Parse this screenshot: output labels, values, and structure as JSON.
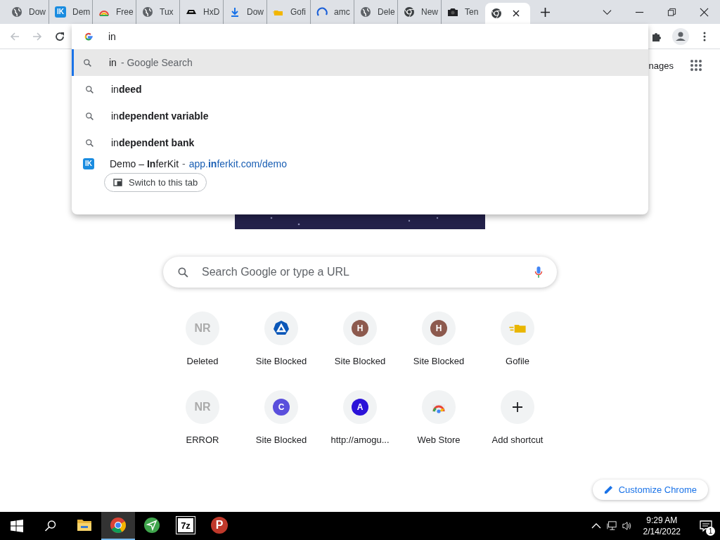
{
  "tabs": [
    {
      "title": "Dow",
      "kind": "globe",
      "selected": false
    },
    {
      "title": "Dem",
      "kind": "badge",
      "glyph": "IK",
      "selected": false
    },
    {
      "title": "Free",
      "kind": "rainbow",
      "selected": false
    },
    {
      "title": "Tux",
      "kind": "globe",
      "selected": false
    },
    {
      "title": "HxD",
      "kind": "hat",
      "selected": false
    },
    {
      "title": "Dow",
      "kind": "download",
      "selected": false
    },
    {
      "title": "Gofi",
      "kind": "folder",
      "selected": false
    },
    {
      "title": "amc",
      "kind": "ring",
      "selected": false
    },
    {
      "title": "Dele",
      "kind": "globe",
      "selected": false
    },
    {
      "title": "New",
      "kind": "chrome",
      "selected": false
    },
    {
      "title": "Ten",
      "kind": "camera",
      "selected": false
    },
    {
      "kind": "chrome",
      "selected": true
    }
  ],
  "toolbar": {
    "back": {
      "disabled": true
    },
    "forward": {
      "disabled": true
    },
    "omnibox": {
      "value": "in"
    }
  },
  "suggestions": [
    {
      "kind": "search",
      "text": "in",
      "description": "- Google Search",
      "selected": true
    },
    {
      "kind": "search",
      "text": "in**deed**",
      "selected": false
    },
    {
      "kind": "search",
      "text": "in**dependent variable**",
      "selected": false
    },
    {
      "kind": "search",
      "text": "in**dependent bank**",
      "selected": false
    },
    {
      "kind": "tab",
      "glyph": "IK",
      "text": "Demo – **In**ferKit",
      "separator": "-",
      "url": "app.**in**ferkit.com/demo",
      "button": "Switch to this tab",
      "selected": false
    }
  ],
  "page": {
    "header_link": "nages",
    "search": {
      "placeholder": "Search Google or type a URL"
    },
    "shortcuts": [
      {
        "label": "Deleted",
        "kind": "monogram",
        "letter": "NR"
      },
      {
        "label": "Site Blocked",
        "kind": "shield"
      },
      {
        "label": "Site Blocked",
        "kind": "letter",
        "letter": "H",
        "color": "#8d5a4e"
      },
      {
        "label": "Site Blocked",
        "kind": "letter",
        "letter": "H",
        "color": "#8d5a4e"
      },
      {
        "label": "Gofile",
        "kind": "folder"
      },
      {
        "label": "ERROR",
        "kind": "monogram",
        "letter": "NR"
      },
      {
        "label": "Site Blocked",
        "kind": "letter",
        "letter": "C",
        "color": "#5a4fdc"
      },
      {
        "label": "http://amogu...",
        "kind": "letter",
        "letter": "A",
        "color": "#2b12d8"
      },
      {
        "label": "Web Store",
        "kind": "store"
      },
      {
        "label": "Add shortcut",
        "kind": "add"
      }
    ],
    "customize_button": "Customize Chrome"
  },
  "taskbar": {
    "apps": [
      {
        "kind": "explorer",
        "selected": false
      },
      {
        "kind": "chrome",
        "selected": true
      },
      {
        "kind": "send",
        "selected": false
      },
      {
        "kind": "tile",
        "glyph": "7z",
        "selected": false
      },
      {
        "kind": "disc",
        "glyph": "P",
        "selected": false
      }
    ],
    "time": "9:29 AM",
    "date": "2/14/2022",
    "notifications": "1"
  }
}
